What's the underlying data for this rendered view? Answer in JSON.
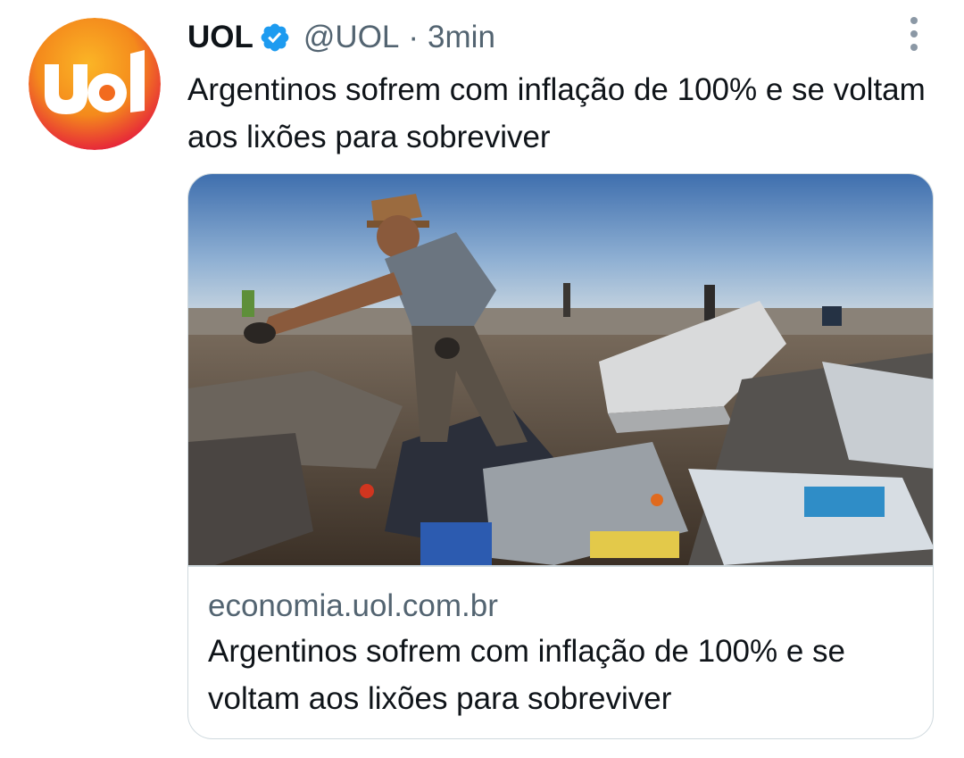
{
  "tweet": {
    "avatar_icon": "uol-logo-icon",
    "display_name": "UOL",
    "verified_icon": "verified-badge-icon",
    "handle": "@UOL",
    "separator": "·",
    "time": "3min",
    "more_icon": "more-options-icon",
    "text": "Argentinos sofrem com inflação de 100% e se voltam aos lixões para sobreviver"
  },
  "card": {
    "domain": "economia.uol.com.br",
    "title": "Argentinos sofrem com inflação de 100% e se voltam aos lixões para sobreviver"
  },
  "colors": {
    "brand_orange": "#f7a21b",
    "brand_red": "#e4173e",
    "verified_blue": "#1d9bf0",
    "text_primary": "#0f1419",
    "text_secondary": "#536471",
    "border": "#cfd9de"
  }
}
